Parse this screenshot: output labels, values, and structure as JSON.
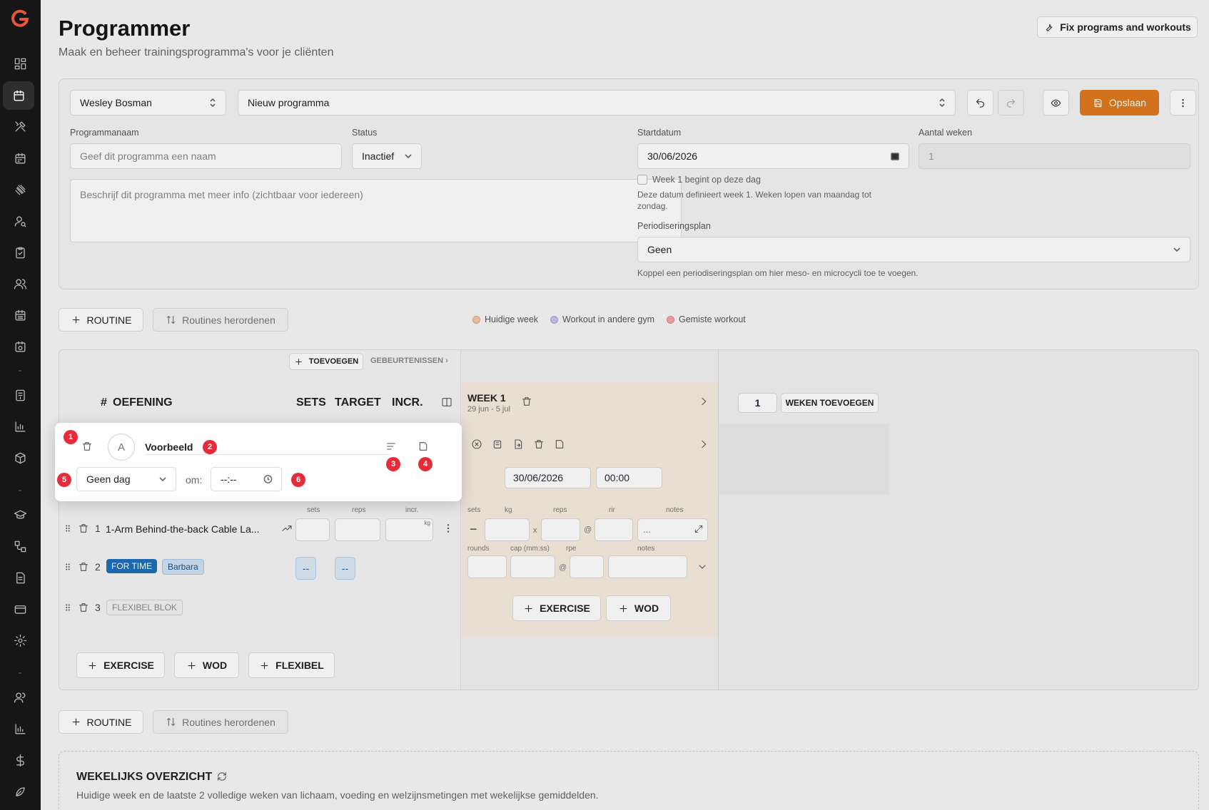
{
  "header": {
    "title": "Programmer",
    "subtitle": "Maak en beheer trainingsprogramma's voor je cliënten",
    "fix_button": "Fix programs and workouts"
  },
  "toolbar": {
    "client": "Wesley Bosman",
    "program": "Nieuw programma",
    "save_label": "Opslaan"
  },
  "form": {
    "name_label": "Programmanaam",
    "name_placeholder": "Geef dit programma een naam",
    "status_label": "Status",
    "status_value": "Inactief",
    "description_placeholder": "Beschrijf dit programma met meer info (zichtbaar voor iedereen)",
    "start_label": "Startdatum",
    "start_value": "30/06/2026",
    "weeks_label": "Aantal weken",
    "weeks_value": "1",
    "week1_checkbox": "Week 1 begint op deze dag",
    "date_hint": "Deze datum definieert week 1. Weken lopen van maandag tot zondag.",
    "period_label": "Periodiseringsplan",
    "period_value": "Geen",
    "period_hint": "Koppel een periodiseringsplan om hier meso- en microcycli toe te voegen."
  },
  "routine_bar": {
    "add_routine": "ROUTINE",
    "reorder": "Routines herordenen"
  },
  "legend": [
    {
      "label": "Huidige week",
      "color": "#f2c9a8"
    },
    {
      "label": "Workout in andere gym",
      "color": "#c9c3ee"
    },
    {
      "label": "Gemiste workout",
      "color": "#f2a7a7"
    }
  ],
  "grid": {
    "add_event": "TOEVOEGEN",
    "events": "GEBEURTENISSEN ›",
    "col_hash": "#",
    "col_exercise": "OEFENING",
    "col_sets": "SETS",
    "col_target": "TARGET",
    "col_incr": "INCR.",
    "week_title": "WEEK 1",
    "week_range": "29 jun - 5 jul",
    "weeks_count": "1",
    "add_weeks": "WEKEN TOEVOEGEN",
    "day_date": "30/06/2026",
    "day_time": "00:00",
    "sub_sets": "sets",
    "sub_reps": "reps",
    "sub_incr": "incr.",
    "kg_unit": "kg",
    "w_sets": "sets",
    "w_kg": "kg",
    "w_reps": "reps",
    "w_rir": "rir",
    "w_notes": "notes",
    "notes_ph": "...",
    "w_rounds": "rounds",
    "w_cap": "cap (mm:ss)",
    "w_rpe": "rpe",
    "w_notes2": "notes",
    "x_sym": "x",
    "at_sym": "@",
    "at_sym2": "@",
    "minus_sym": "−",
    "row1_num": "1",
    "row1_name": "1-Arm Behind-the-back Cable La...",
    "row2_num": "2",
    "row2_tag1": "FOR TIME",
    "row2_tag2": "Barbara",
    "row2_sets": "--",
    "row2_target": "--",
    "row3_num": "3",
    "row3_tag": "FLEXIBEL BLOK",
    "add_exercise": "EXERCISE",
    "add_wod": "WOD",
    "add_flex": "FLEXIBEL",
    "week_add_exercise": "EXERCISE",
    "week_add_wod": "WOD"
  },
  "popup": {
    "avatar": "A",
    "name": "Voorbeeld",
    "day": "Geen dag",
    "om": "om:",
    "time": "--:--",
    "markers": [
      "1",
      "2",
      "3",
      "4",
      "5",
      "6"
    ]
  },
  "bottom_bar": {
    "add_routine": "ROUTINE",
    "reorder": "Routines herordenen"
  },
  "weekly": {
    "title": "WEKELIJKS OVERZICHT",
    "desc": "Huidige week en de laatste 2 volledige weken van lichaam, voeding en welzijnsmetingen met wekelijkse gemiddelden."
  },
  "colors": {
    "accent": "#e07a1f",
    "badge": "#e42c3a",
    "tag_blue": "#1d6fb8"
  }
}
